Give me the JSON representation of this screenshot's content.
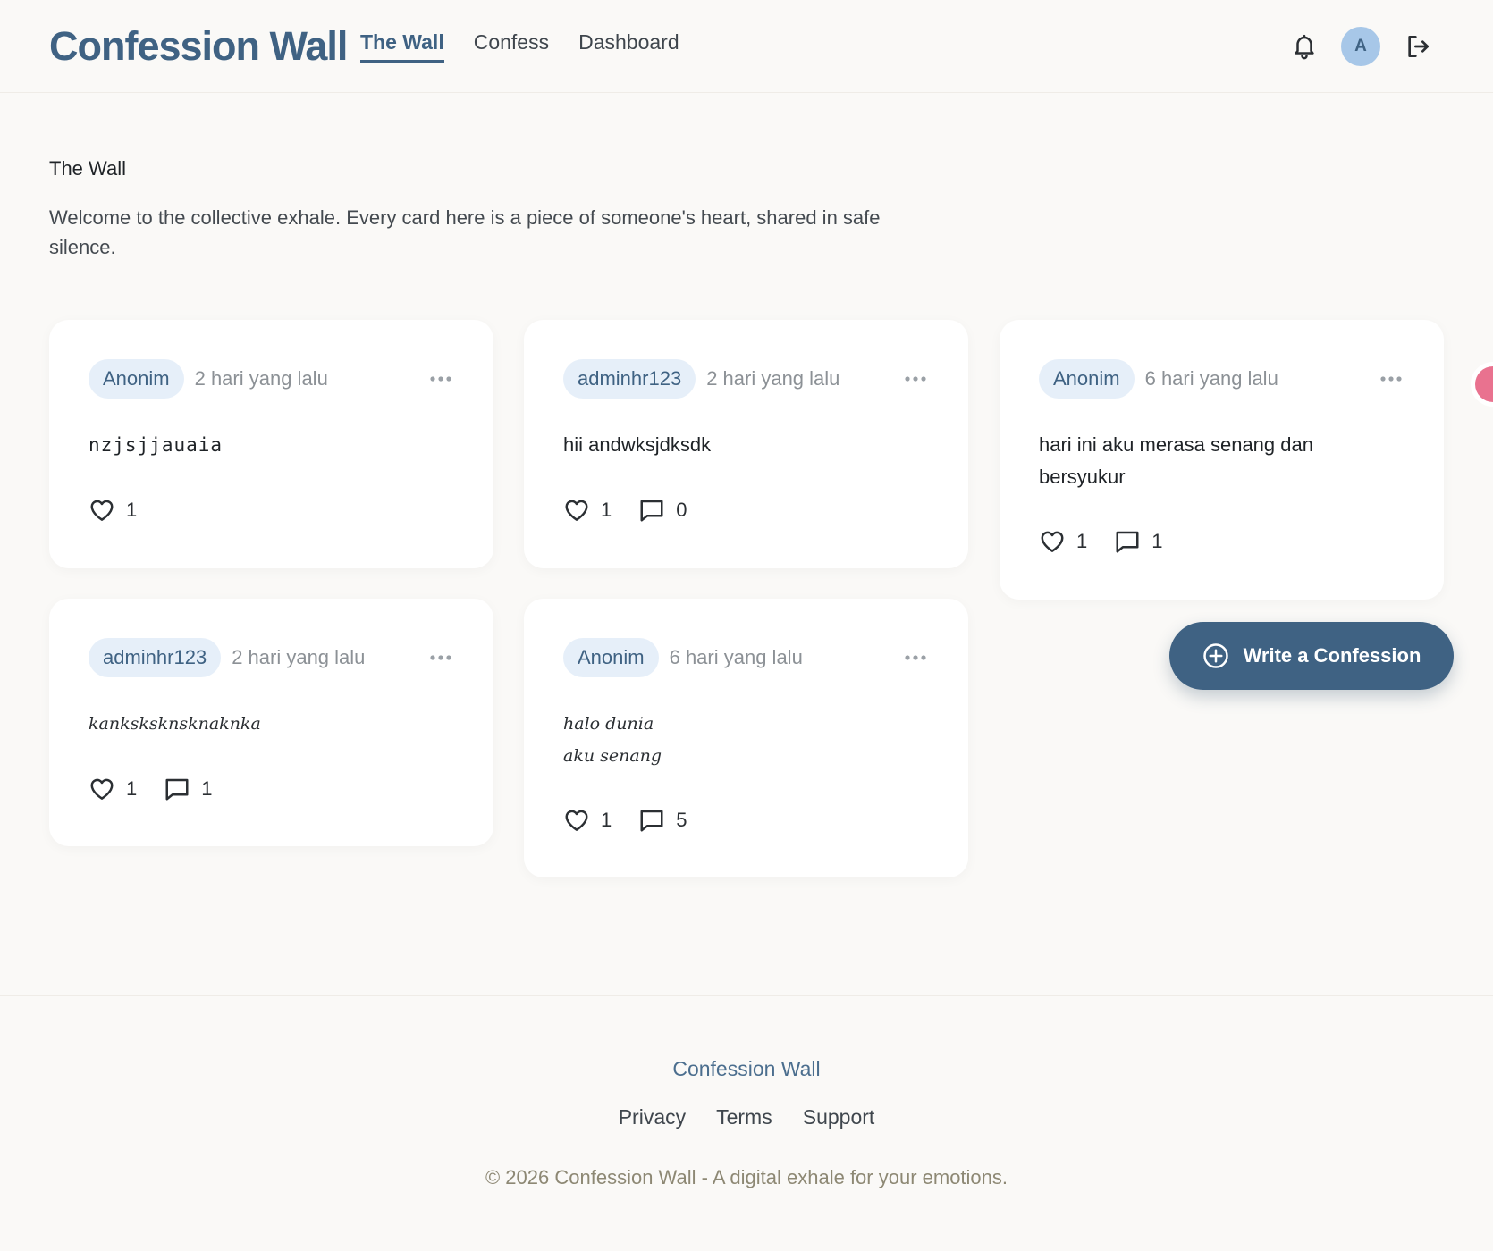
{
  "header": {
    "brand": "Confession Wall",
    "nav": [
      {
        "label": "The Wall",
        "active": true
      },
      {
        "label": "Confess"
      },
      {
        "label": "Dashboard"
      }
    ],
    "avatar_initial": "A",
    "icons": [
      "bell-icon",
      "logout-icon"
    ]
  },
  "intro": {
    "title": "The Wall",
    "description": "Welcome to the collective exhale. Every card here is a piece of someone's heart, shared in safe silence."
  },
  "cards": [
    {
      "author": "Anonim",
      "time": "2 hari yang lalu",
      "text": "nzjsjjauaia",
      "likes": "1",
      "comments": null
    },
    {
      "author": "adminhr123",
      "time": "2 hari yang lalu",
      "text": "hii andwksjdksdk",
      "likes": "1",
      "comments": "0"
    },
    {
      "author": "Anonim",
      "time": "6 hari yang lalu",
      "text": "hari ini aku merasa senang dan bersyukur",
      "likes": "1",
      "comments": "1"
    },
    {
      "author": "adminhr123",
      "time": "2 hari yang lalu",
      "text": "kanksksknsknaknka",
      "likes": "1",
      "comments": "1"
    },
    {
      "author": "Anonim",
      "time": "6 hari yang lalu",
      "text": "halo dunia\naku senang",
      "likes": "1",
      "comments": "5"
    }
  ],
  "fab": {
    "label": "Write a Confession"
  },
  "footer": {
    "brand": "Confession Wall",
    "links": [
      "Privacy",
      "Terms",
      "Support"
    ],
    "copyright": "© 2026 Confession Wall - A digital exhale for your emotions."
  },
  "colors": {
    "primary": "#3f6283",
    "background": "#faf9f7",
    "author_pill": "#e6eff9",
    "avatar": "#a7c7e8"
  }
}
